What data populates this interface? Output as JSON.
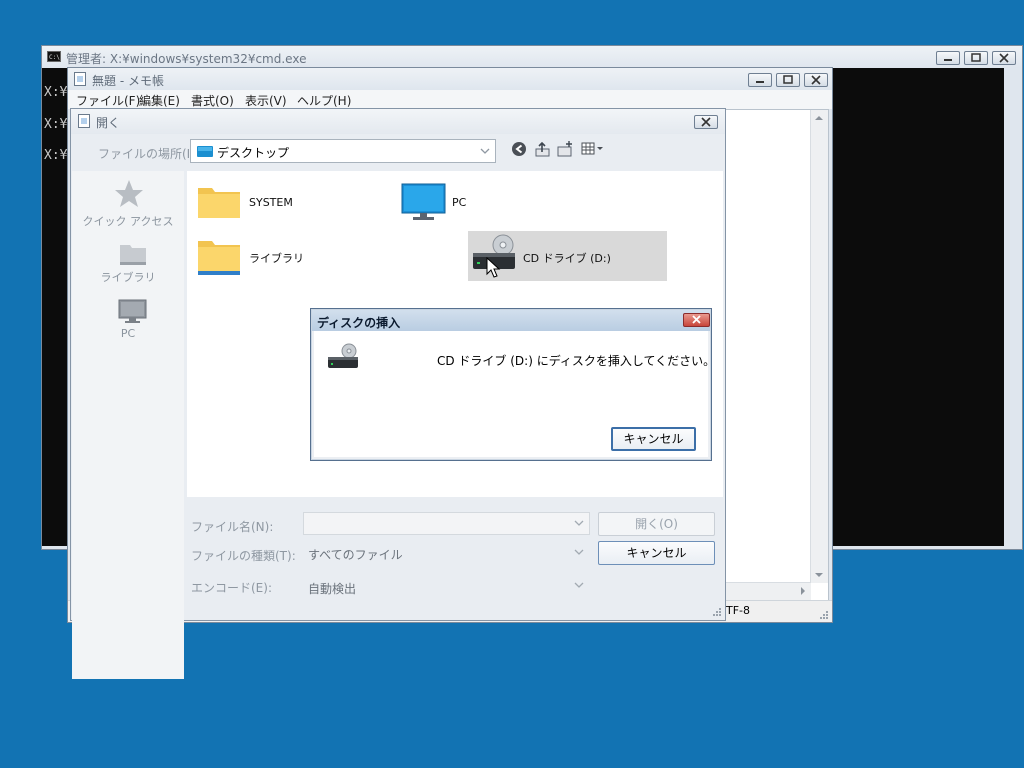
{
  "cmd": {
    "title": "管理者: X:¥windows¥system32¥cmd.exe",
    "lines": [
      "X:¥",
      "X:¥",
      "X:¥"
    ]
  },
  "notepad": {
    "title": "無題 - メモ帳",
    "menu": [
      "ファイル(F)",
      "編集(E)",
      "書式(O)",
      "表示(V)",
      "ヘルプ(H)"
    ],
    "status_encoding": "TF-8"
  },
  "open_dialog": {
    "title": "開く",
    "location_label": "ファイルの場所(I):",
    "location_value": "デスクトップ",
    "places": [
      {
        "label": "クイック アクセス",
        "icon": "star-icon"
      },
      {
        "label": "ライブラリ",
        "icon": "library-icon"
      },
      {
        "label": "PC",
        "icon": "pc-icon"
      }
    ],
    "files": [
      {
        "label": "SYSTEM",
        "icon": "folder-icon"
      },
      {
        "label": "PC",
        "icon": "monitor-icon"
      },
      {
        "label": "ライブラリ",
        "icon": "library-folder-icon"
      },
      {
        "label": "CD ドライブ (D:)",
        "icon": "cd-drive-icon",
        "selected": true
      }
    ],
    "filename_label": "ファイル名(N):",
    "filename_value": "",
    "filetype_label": "ファイルの種類(T):",
    "filetype_value": "すべてのファイル",
    "encoding_label": "エンコード(E):",
    "encoding_value": "自動検出",
    "open_button": "開く(O)",
    "cancel_button": "キャンセル"
  },
  "insert_disk": {
    "title": "ディスクの挿入",
    "message": "CD ドライブ (D:) にディスクを挿入してください。",
    "cancel_button": "キャンセル"
  },
  "colors": {
    "desktop": "#1273b3",
    "console": "#0c0c0c",
    "button_border": "#6d8fb8"
  }
}
